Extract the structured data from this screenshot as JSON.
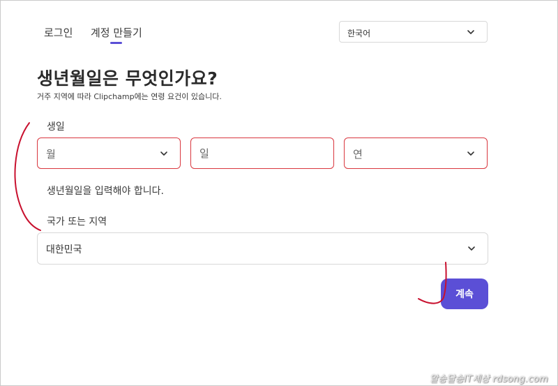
{
  "tabs": {
    "login": "로그인",
    "signup": "계정 만들기"
  },
  "language": {
    "selected": "한국어"
  },
  "heading": {
    "title": "생년월일은 무엇인가요?",
    "subtitle": "거주 지역에 따라 Clipchamp에는 연령 요건이 있습니다."
  },
  "birthdate": {
    "label": "생일",
    "month_placeholder": "월",
    "day_placeholder": "일",
    "year_placeholder": "연",
    "error": "생년월일을 입력해야 합니다."
  },
  "country": {
    "label": "국가 또는 지역",
    "selected": "대한민국"
  },
  "actions": {
    "continue": "계속"
  },
  "watermark": "알송달송IT세상 rdsong.com",
  "colors": {
    "accent": "#5b4fd6",
    "error_border": "#d9363e",
    "annotation": "#c8102e"
  },
  "icons": {
    "dropdown": "chevron-down-icon"
  }
}
